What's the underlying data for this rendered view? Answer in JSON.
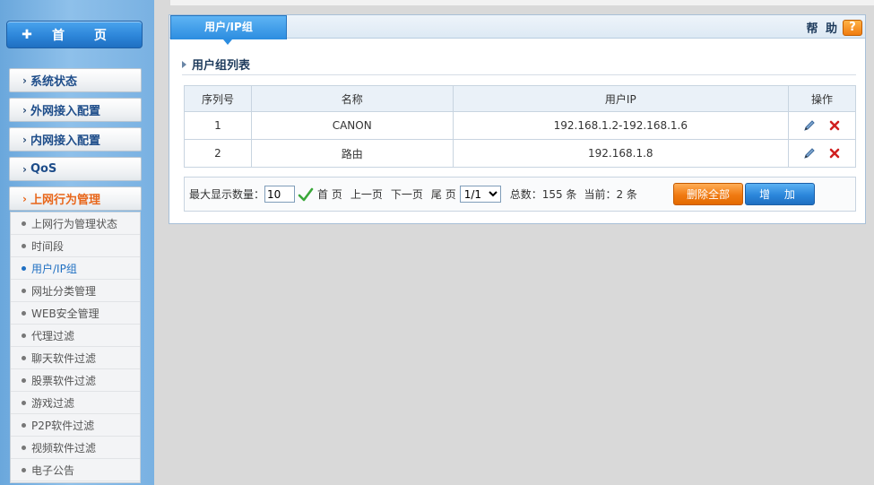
{
  "sidebar": {
    "home": {
      "icon": "plus-icon",
      "label": "首 页"
    },
    "items": [
      {
        "label": "系统状态"
      },
      {
        "label": "外网接入配置"
      },
      {
        "label": "内网接入配置"
      },
      {
        "label": "QoS"
      },
      {
        "label": "上网行为管理"
      }
    ],
    "submenu": [
      {
        "label": "上网行为管理状态"
      },
      {
        "label": "时间段"
      },
      {
        "label": "用户/IP组"
      },
      {
        "label": "网址分类管理"
      },
      {
        "label": "WEB安全管理"
      },
      {
        "label": "代理过滤"
      },
      {
        "label": "聊天软件过滤"
      },
      {
        "label": "股票软件过滤"
      },
      {
        "label": "游戏过滤"
      },
      {
        "label": "P2P软件过滤"
      },
      {
        "label": "视频软件过滤"
      },
      {
        "label": "电子公告"
      }
    ]
  },
  "panel": {
    "tab": "用户/IP组",
    "help": "帮 助",
    "help_icon": "?",
    "section_title": "用户组列表"
  },
  "table": {
    "headers": [
      "序列号",
      "名称",
      "用户IP",
      "操作"
    ],
    "rows": [
      {
        "index": "1",
        "name": "CANON",
        "ip": "192.168.1.2-192.168.1.6"
      },
      {
        "index": "2",
        "name": "路由",
        "ip": "192.168.1.8"
      }
    ]
  },
  "pager": {
    "max_label": "最大显示数量：",
    "max_value": "10",
    "first": "首 页",
    "prev": "上一页",
    "next": "下一页",
    "last": "尾 页",
    "page_value": "1/1",
    "total": "总数：155 条",
    "current": "当前：2 条",
    "delete_all": "删除全部",
    "add": "增 加"
  },
  "colors": {
    "accent_blue": "#2c8de0",
    "accent_orange": "#f07a12",
    "active_nav": "#e8661a"
  }
}
